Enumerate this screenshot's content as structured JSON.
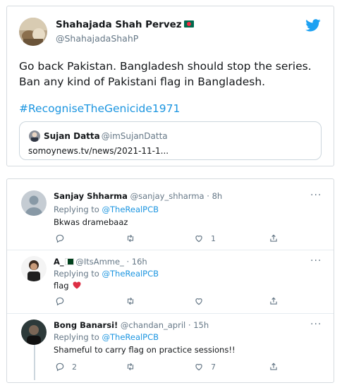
{
  "tweet": {
    "author_name": "Shahajada Shah Pervez",
    "author_handle": "@ShahajadaShahP",
    "body": "Go back Pakistan. Bangladesh should stop the series. Ban any kind of Pakistani flag in Bangladesh.",
    "hashtag": "#RecogniseTheGenicide1971",
    "quote": {
      "author_name": "Sujan Datta",
      "author_handle": "@imSujanDatta",
      "link": "somoynews.tv/news/2021-11-1..."
    },
    "icons": {
      "brand": "twitter-bird-icon",
      "flag": "bangladesh-flag-icon"
    },
    "colors": {
      "brand": "#1da1f2",
      "link": "#1b95e0"
    }
  },
  "replies": [
    {
      "name": "Sanjay Shharma",
      "handle": "@sanjay_shharma",
      "time": "· 8h",
      "replying_label": "Replying to",
      "replying_to": "@TheRealPCB",
      "text": "Bkwas dramebaaz",
      "reply_count": "",
      "retweet_count": "",
      "like_count": "1"
    },
    {
      "name": "A_",
      "handle": "@ItsAmme_",
      "time": "· 16h",
      "replying_label": "Replying to",
      "replying_to": "@TheRealPCB",
      "text": "flag",
      "reply_count": "",
      "retweet_count": "",
      "like_count": ""
    },
    {
      "name": "Bong Banarsi!",
      "handle": "@chandan_april",
      "time": "· 15h",
      "replying_label": "Replying to",
      "replying_to": "@TheRealPCB",
      "text": "Shameful to carry flag on practice sessions!!",
      "reply_count": "2",
      "retweet_count": "",
      "like_count": "7"
    }
  ],
  "more_label": "···"
}
